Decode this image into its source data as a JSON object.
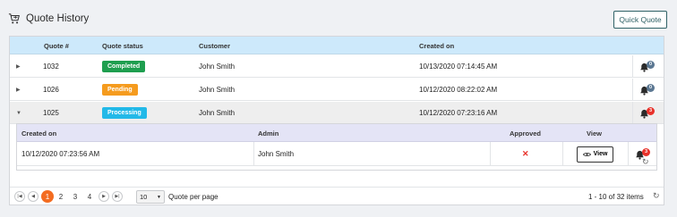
{
  "header": {
    "title": "Quote History",
    "quick_quote_label": "Quick Quote"
  },
  "grid": {
    "columns": {
      "quote_no": "Quote #",
      "status": "Quote status",
      "customer": "Customer",
      "created_on": "Created on"
    },
    "rows": [
      {
        "quote_no": "1032",
        "status": "Completed",
        "status_color": "#1e9e4f",
        "customer": "John Smith",
        "created_on": "10/13/2020 07:14:45 AM",
        "bell_count": "0",
        "bell_badge_color": "#5b7792"
      },
      {
        "quote_no": "1026",
        "status": "Pending",
        "status_color": "#f59b1e",
        "customer": "John Smith",
        "created_on": "10/12/2020 08:22:02 AM",
        "bell_count": "0",
        "bell_badge_color": "#5b7792"
      },
      {
        "quote_no": "1025",
        "status": "Processing",
        "status_color": "#22b9e8",
        "customer": "John Smith",
        "created_on": "10/12/2020 07:23:16 AM",
        "bell_count": "3",
        "bell_badge_color": "#e8312a"
      }
    ]
  },
  "detail": {
    "columns": {
      "created_on": "Created on",
      "admin": "Admin",
      "approved": "Approved",
      "view": "View"
    },
    "row": {
      "created_on": "10/12/2020 07:23:56 AM",
      "admin": "John Smith",
      "approved_icon": "x-icon",
      "view_label": "View",
      "bell_count": "3"
    }
  },
  "pager": {
    "pages": [
      "1",
      "2",
      "3",
      "4"
    ],
    "current_page": "1",
    "page_size": "10",
    "page_size_label": "Quote per page",
    "info": "1 - 10 of 32 items"
  },
  "colors": {
    "accent": "#f36c21",
    "header_bg": "#cde9fb",
    "detail_header_bg": "#e4e4f6"
  }
}
